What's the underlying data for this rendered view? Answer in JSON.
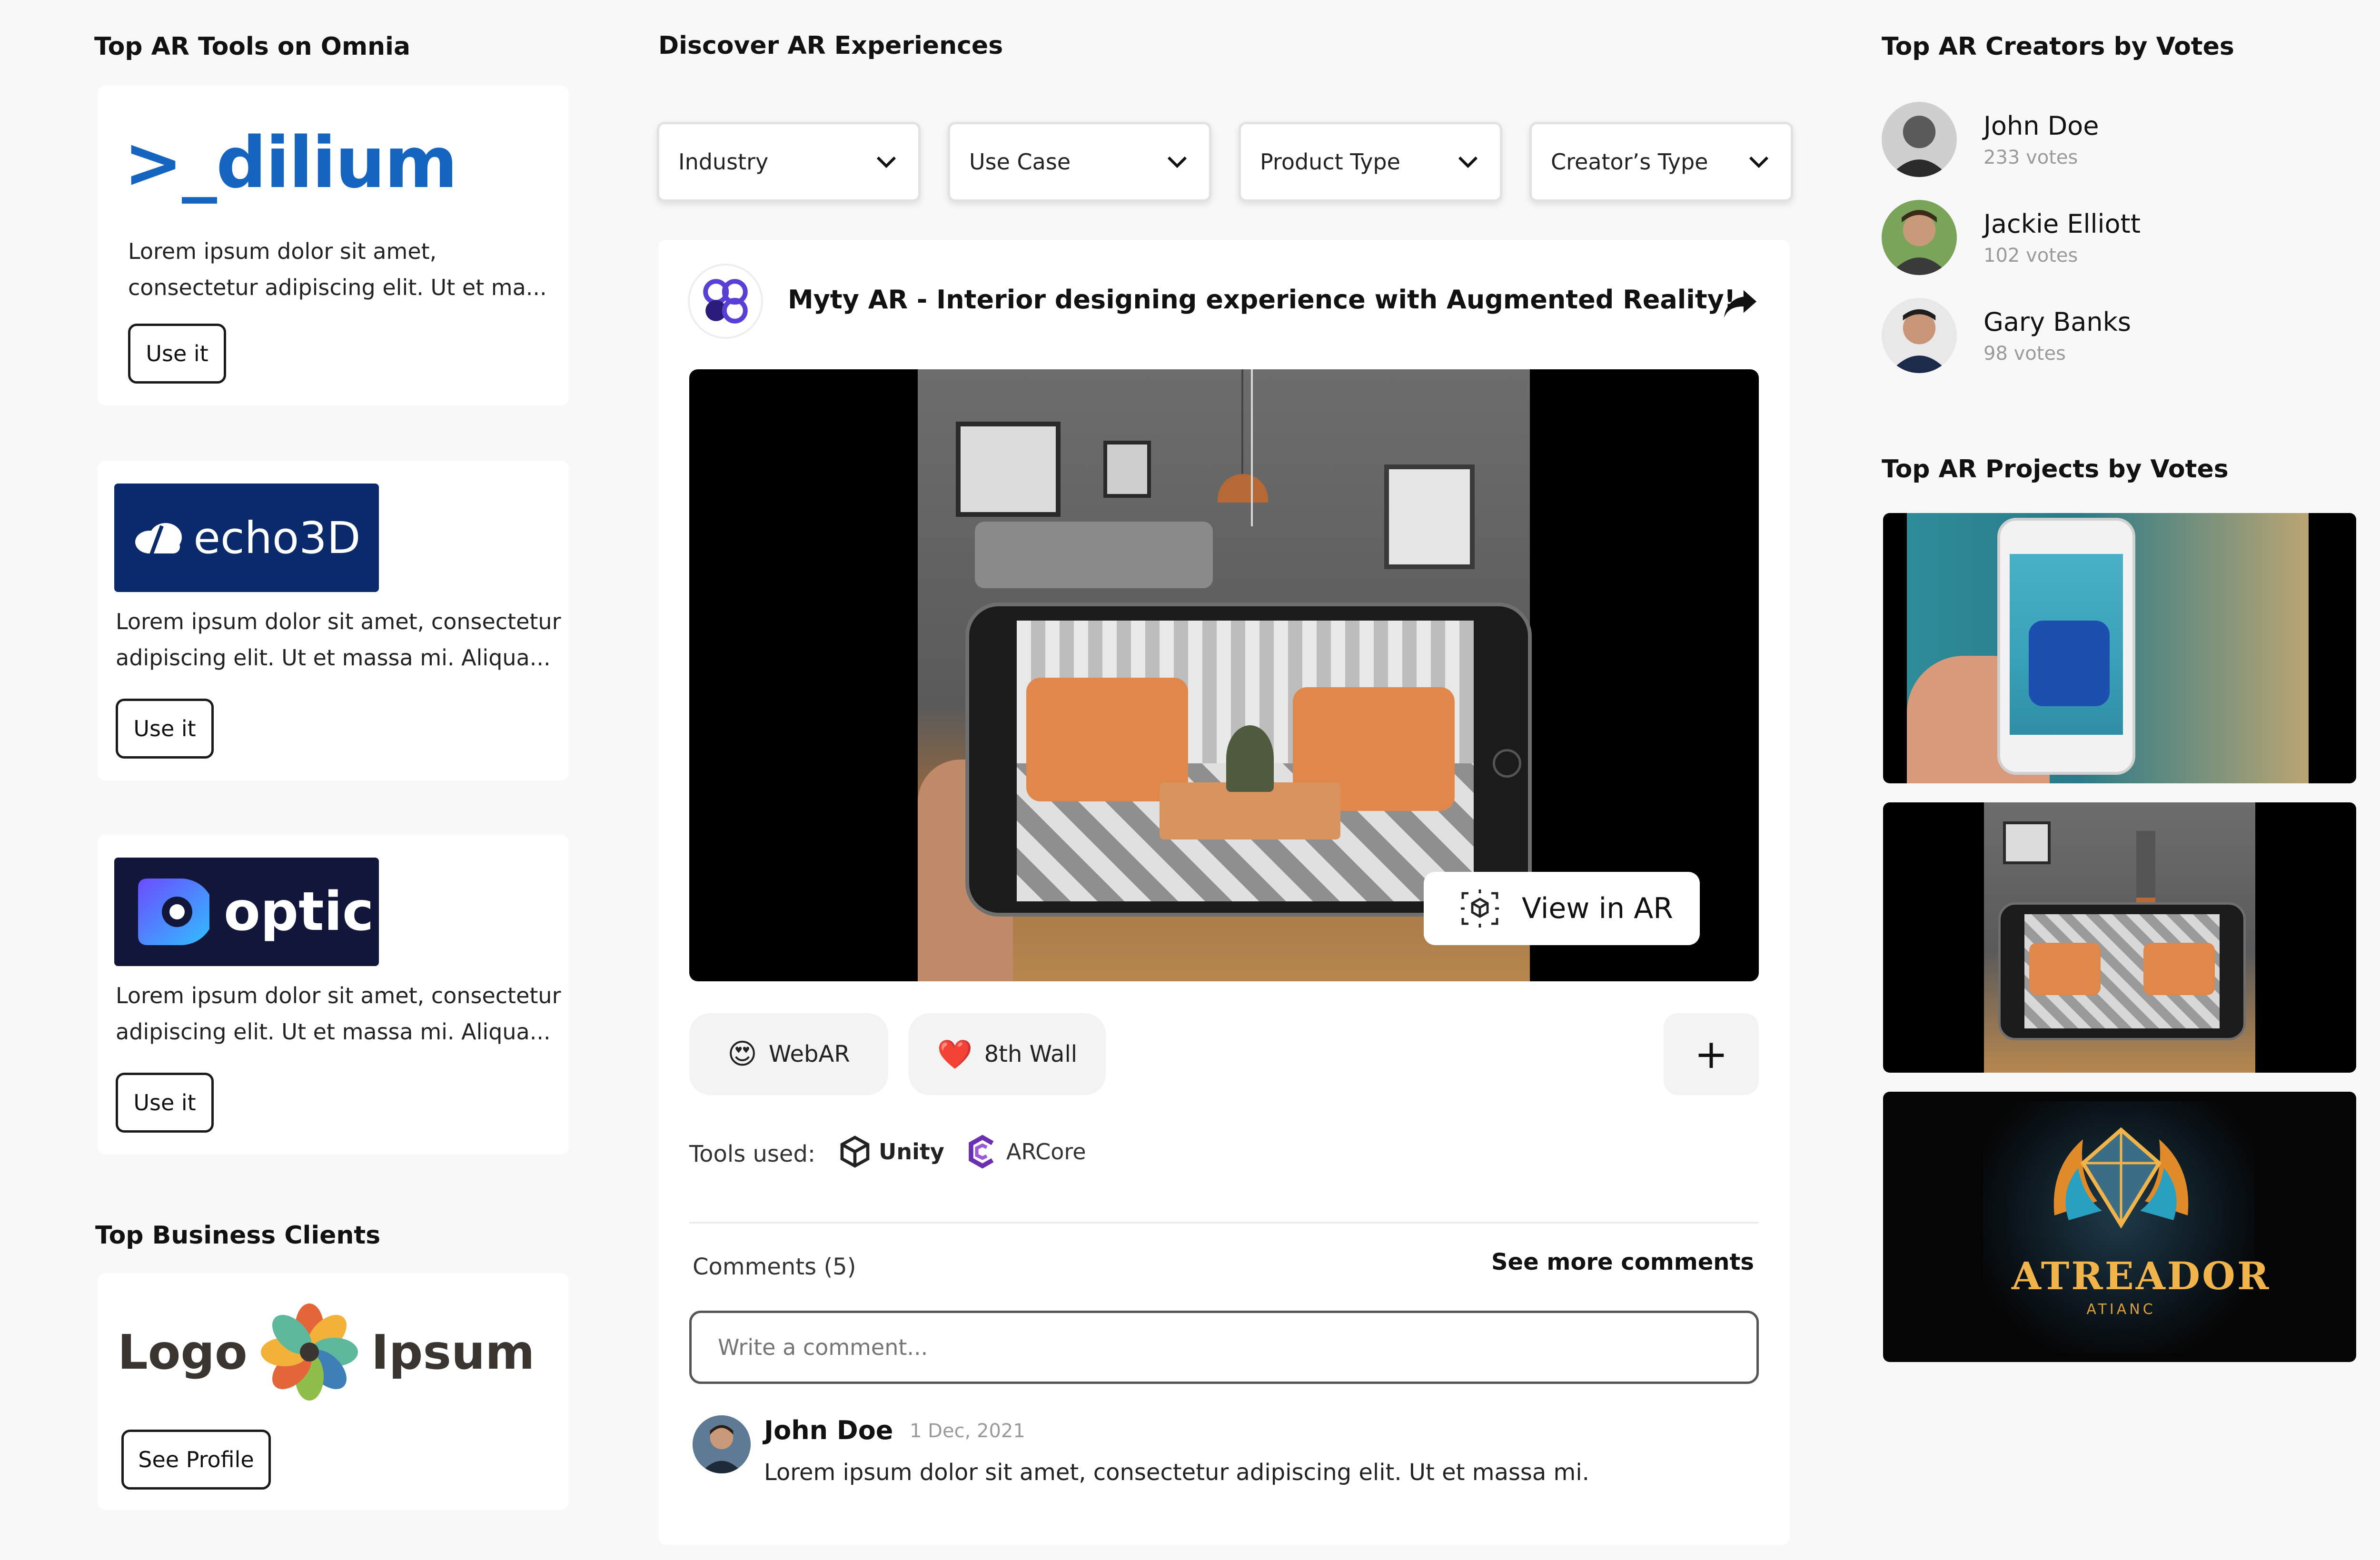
{
  "left": {
    "tools_title": "Top AR Tools on Omnia",
    "tools": [
      {
        "logo_text": ">_dilium",
        "desc_line1": "Lorem ipsum dolor sit amet,",
        "desc_line2": "consectetur adipiscing elit. Ut et ma...",
        "button": "Use it"
      },
      {
        "logo_text": "echo3D",
        "desc_line1": "Lorem ipsum dolor sit amet, consectetur",
        "desc_line2": "adipiscing elit. Ut et massa mi. Aliqua...",
        "button": "Use it"
      },
      {
        "logo_text": "optic",
        "desc_line1": "Lorem ipsum dolor sit amet, consectetur",
        "desc_line2": "adipiscing elit. Ut et massa mi. Aliqua...",
        "button": "Use it"
      }
    ],
    "clients_title": "Top Business Clients",
    "client": {
      "logo_left": "Logo",
      "logo_right": "Ipsum",
      "button": "See Profile"
    }
  },
  "center": {
    "title": "Discover AR Experiences",
    "filters": [
      "Industry",
      "Use Case",
      "Product Type",
      "Creator’s Type"
    ],
    "post": {
      "title": "Myty AR - Interior designing experience with Augmented Reality!",
      "view_ar": "View in AR",
      "tags": [
        {
          "emoji": "😍",
          "label": "WebAR"
        },
        {
          "emoji": "❤️",
          "label": "8th Wall"
        }
      ],
      "add_symbol": "+",
      "tools_label": "Tools used:",
      "tools": [
        "Unity",
        "ARCore"
      ],
      "comments_label": "Comments (5)",
      "see_more": "See more comments",
      "comment_placeholder": "Write a comment...",
      "comment": {
        "author": "John Doe",
        "date": "1 Dec, 2021",
        "text": "Lorem ipsum dolor sit amet, consectetur adipiscing elit. Ut et massa mi."
      }
    }
  },
  "right": {
    "creators_title": "Top AR Creators by Votes",
    "creators": [
      {
        "name": "John Doe",
        "votes": "233 votes"
      },
      {
        "name": "Jackie Elliott",
        "votes": "102 votes"
      },
      {
        "name": "Gary Banks",
        "votes": "98 votes"
      }
    ],
    "projects_title": "Top AR Projects by Votes",
    "project3_logo": "ATREADOR",
    "project3_sub": "ATIANC"
  },
  "colors": {
    "dilium_blue": "#1565c0",
    "echo_navy": "#0b2a6b",
    "optic_dark": "#12163a",
    "myty_purple": "#5a3fd6",
    "arcore_purple": "#6b2fb3"
  }
}
